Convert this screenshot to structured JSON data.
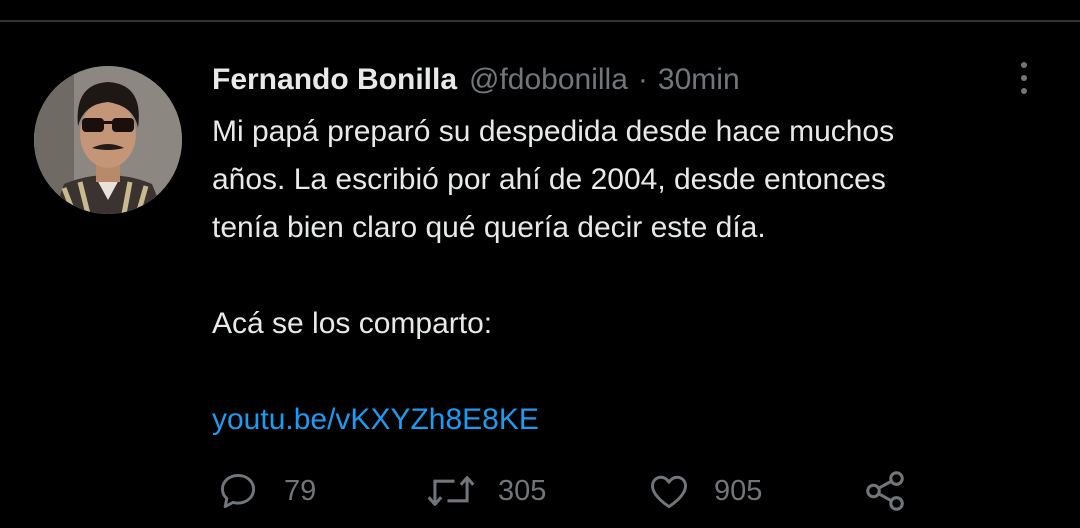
{
  "tweet": {
    "author": {
      "display_name": "Fernando Bonilla",
      "handle": "@fdobonilla",
      "separator": "·",
      "time": "30min"
    },
    "body": {
      "lines_p1": [
        "Mi papá preparó su despedida desde hace muchos",
        "años. La escribió por ahí de 2004, desde entonces",
        "tenía bien claro qué quería decir este día."
      ],
      "line_p2": "Acá se los comparto:",
      "link": "youtu.be/vKXYZh8E8KE"
    },
    "actions": {
      "replies": "79",
      "retweets": "305",
      "likes": "905"
    }
  },
  "icons": {
    "reply": "speech-bubble",
    "retweet": "retweet-arrows",
    "like": "heart-outline",
    "share": "share-nodes",
    "more": "vertical-ellipsis"
  },
  "colors": {
    "background": "#000000",
    "text": "#e7e9ea",
    "secondary": "#71767b",
    "link": "#1d9bf0",
    "divider": "#2f3336"
  }
}
